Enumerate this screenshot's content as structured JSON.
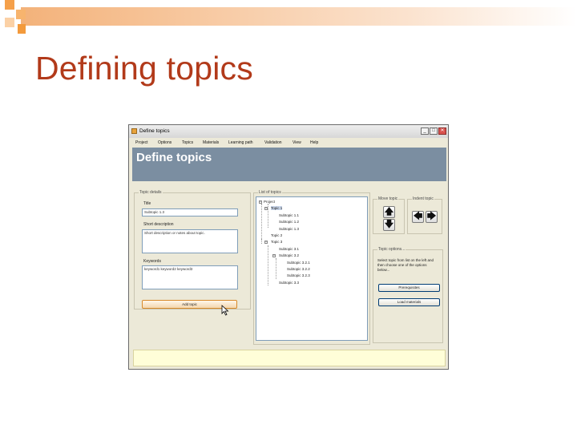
{
  "slide": {
    "title": "Defining topics"
  },
  "window": {
    "title": "Define topics",
    "controls": {
      "minimize": "_",
      "maximize": "□",
      "close": "✕"
    },
    "menu": [
      "Project",
      "Options",
      "Topics",
      "Materials",
      "Learning path",
      "Validation",
      "View",
      "Help"
    ],
    "banner_title": "Define topics",
    "topic_details": {
      "group_label": "Topic details",
      "title_label": "Title",
      "title_value": "Subtopic 1.3",
      "short_desc_label": "Short description",
      "short_desc_value": "Short description or notes about topic.",
      "keywords_label": "Keywords",
      "keywords_value": "keyword1 keyword2 keyword3",
      "add_button": "Add topic"
    },
    "list_of_topics": {
      "group_label": "List of topics",
      "items": [
        {
          "text": "Project",
          "level": 0,
          "expander": "⊟"
        },
        {
          "text": "Topic 1",
          "level": 1,
          "expander": "⊟",
          "selected": true
        },
        {
          "text": "Subtopic 1.1",
          "level": 2
        },
        {
          "text": "Subtopic 1.2",
          "level": 2
        },
        {
          "text": "Subtopic 1.3",
          "level": 2
        },
        {
          "text": "Topic 2",
          "level": 1
        },
        {
          "text": "Topic 3",
          "level": 1,
          "expander": "⊟"
        },
        {
          "text": "Subtopic 3.1",
          "level": 2
        },
        {
          "text": "Subtopic 3.2",
          "level": 2,
          "expander": "⊟"
        },
        {
          "text": "Subtopic 3.2.1",
          "level": 3
        },
        {
          "text": "Subtopic 3.2.2",
          "level": 3
        },
        {
          "text": "Subtopic 3.2.3",
          "level": 3
        },
        {
          "text": "Subtopic 3.3",
          "level": 2
        }
      ]
    },
    "move_topic": {
      "label": "Move topic",
      "up": "🡅",
      "down": "🡇"
    },
    "indent_topic": {
      "label": "Indent topic",
      "left": "🡄",
      "right": "🡆"
    },
    "topic_options": {
      "group_label": "Topic options...",
      "help_text": "Select topic from list on the left and then choose one of the options below...",
      "prerequisites_button": "Prerequisites",
      "load_materials_button": "Load materials"
    }
  }
}
